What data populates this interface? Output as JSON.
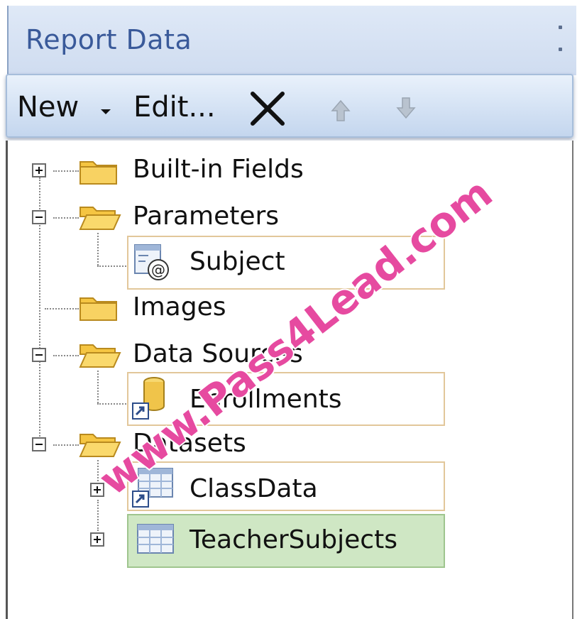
{
  "panel": {
    "title": "Report Data"
  },
  "toolbar": {
    "new_label": "New",
    "edit_label": "Edit...",
    "icons": {
      "new_menu": "chevron-down-icon",
      "delete": "close-icon",
      "move_up": "arrow-up-icon",
      "move_down": "arrow-down-icon"
    }
  },
  "tree": {
    "builtin_fields": {
      "label": "Built-in Fields",
      "expanded": false
    },
    "parameters": {
      "label": "Parameters",
      "expanded": true,
      "children": [
        {
          "label": "Subject"
        }
      ]
    },
    "images": {
      "label": "Images"
    },
    "data_sources": {
      "label": "Data Sources",
      "expanded": true,
      "children": [
        {
          "label": "Enrollments"
        }
      ]
    },
    "datasets": {
      "label": "Datasets",
      "expanded": true,
      "children": [
        {
          "label": "ClassData",
          "expanded": false
        },
        {
          "label": "TeacherSubjects",
          "expanded": false,
          "selected": true
        }
      ]
    }
  },
  "watermark": {
    "text": "www.Pass4Lead.com",
    "color": "#e64aa0"
  },
  "colors": {
    "title_text": "#3a5a9a",
    "title_bar": "#d6e2f3",
    "selection_fill": "#cfe7c4",
    "item_border": "#e2c79a",
    "folder": "#f5c542"
  }
}
